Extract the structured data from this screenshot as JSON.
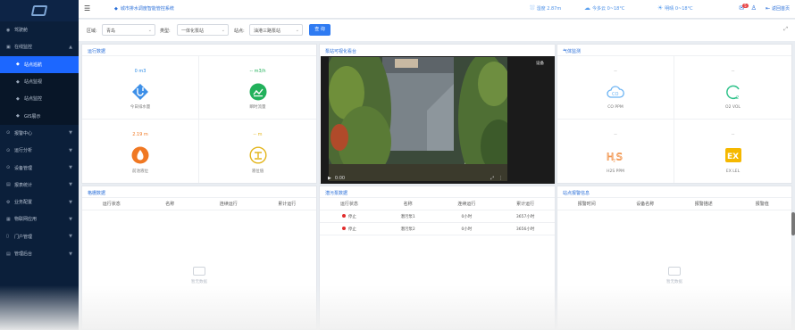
{
  "sidebar": {
    "items": [
      {
        "label": "驾驶舱",
        "icon": "dashboard-icon",
        "chevron": ""
      },
      {
        "label": "在线监控",
        "icon": "monitor-icon",
        "chevron": "▲"
      },
      {
        "label": "站点巡航",
        "icon": "cruise-icon",
        "chevron": ""
      },
      {
        "label": "站点监视",
        "icon": "station-icon",
        "chevron": ""
      },
      {
        "label": "站点监控",
        "icon": "station-icon",
        "chevron": ""
      },
      {
        "label": "GIS展示",
        "icon": "map-icon",
        "chevron": ""
      },
      {
        "label": "报警中心",
        "icon": "alarm-icon",
        "chevron": "▼"
      },
      {
        "label": "运行分析",
        "icon": "analysis-icon",
        "chevron": "▼"
      },
      {
        "label": "设备管理",
        "icon": "device-icon",
        "chevron": "▼"
      },
      {
        "label": "报表统计",
        "icon": "report-icon",
        "chevron": "▼"
      },
      {
        "label": "业务配置",
        "icon": "config-icon",
        "chevron": "▼"
      },
      {
        "label": "物联网应用",
        "icon": "iot-icon",
        "chevron": "▼"
      },
      {
        "label": "门户管理",
        "icon": "portal-icon",
        "chevron": "▼"
      },
      {
        "label": "管理后台",
        "icon": "admin-icon",
        "chevron": "▼"
      }
    ]
  },
  "header": {
    "title": "城市排水调度智能管控系统",
    "weather": [
      {
        "icon": "humidity-icon",
        "text": "湿度 2.87m"
      },
      {
        "icon": "cloud-icon",
        "text": "今多云 0~18°C"
      },
      {
        "icon": "sun-icon",
        "text": "明晴 0~18°C"
      }
    ],
    "notify_count": "5",
    "back_label": "返回首页"
  },
  "filters": {
    "area_label": "区域:",
    "area_value": "青岛",
    "type_label": "类型:",
    "type_value": "一体化泵站",
    "station_label": "站点:",
    "station_value": "油港三路泵站",
    "query_label": "查 询"
  },
  "run_panel": {
    "title": "运行数据",
    "stats": [
      {
        "value": "0 m3",
        "label": "今日排水量",
        "color": "#2b8be6"
      },
      {
        "value": "-- m3/h",
        "label": "瞬时流量",
        "color": "#22b15b"
      },
      {
        "value": "2.19 m",
        "label": "前池液位",
        "color": "#f07823"
      },
      {
        "value": "-- m",
        "label": "液位值",
        "color": "#e3b51b"
      }
    ]
  },
  "video_panel": {
    "title": "泵站可视化看台",
    "tag": "设备",
    "time": "0:00"
  },
  "gas_panel": {
    "title": "气体监测",
    "stats": [
      {
        "value": "--",
        "label": "CO PPM"
      },
      {
        "value": "--",
        "label": "O2 VOL"
      },
      {
        "value": "--",
        "label": "H2S PPM"
      },
      {
        "value": "--",
        "label": "EX LEL"
      }
    ]
  },
  "gate_table": {
    "title": "格栅数据",
    "headers": [
      "运行状态",
      "名称",
      "连续运行",
      "累计运行"
    ],
    "empty_text": "暂无数据"
  },
  "pump_table": {
    "title": "潜污泵数据",
    "headers": [
      "运行状态",
      "名称",
      "连续运行",
      "累计运行"
    ],
    "rows": [
      [
        "停止",
        "潜污泵1",
        "0小时",
        "3657小时"
      ],
      [
        "停止",
        "潜污泵2",
        "0小时",
        "3656小时"
      ]
    ]
  },
  "alarm_table": {
    "title": "站点报警信息",
    "headers": [
      "报警时间",
      "设备名称",
      "报警描述",
      "报警值"
    ],
    "empty_text": "暂无数据"
  }
}
